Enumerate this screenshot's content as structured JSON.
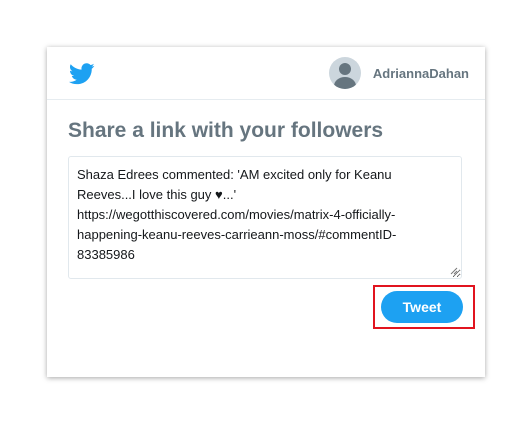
{
  "header": {
    "logo_icon": "twitter-bird-icon",
    "username": "AdriannaDahan",
    "avatar_icon": "default-avatar-icon"
  },
  "main": {
    "title": "Share a link with your followers",
    "tweet_text_lines": [
      "Shaza Edrees commented: 'AM excited only for Keanu",
      "Reeves...I love this guy ♥...'",
      "https://wegotthiscovered.com/movies/matrix-4-officially-",
      "happening-keanu-reeves-carrieann-moss/#commentID-",
      "83385986"
    ],
    "tweet_button_label": "Tweet"
  },
  "colors": {
    "brand": "#1da1f2",
    "title_text": "#66757f",
    "highlight": "#e1141f"
  }
}
